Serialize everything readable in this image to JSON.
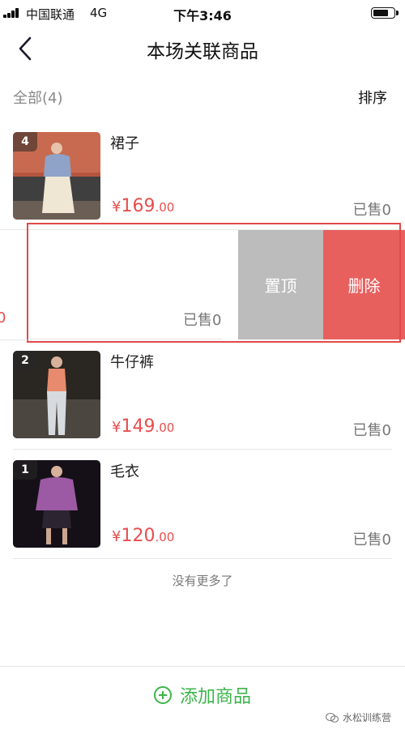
{
  "status_bar": {
    "carrier": "中国联通",
    "network": "4G",
    "time": "下午3:46"
  },
  "nav": {
    "title": "本场关联商品"
  },
  "filter": {
    "all_label": "全部(4)",
    "sort_label": "排序"
  },
  "products": [
    {
      "rank": "4",
      "name": "裙子",
      "currency": "¥",
      "price_int": "169",
      "price_dec": ".00",
      "sold": "已售0"
    },
    {
      "rank": "2",
      "name": "牛仔裤",
      "currency": "¥",
      "price_int": "149",
      "price_dec": ".00",
      "sold": "已售0"
    },
    {
      "rank": "1",
      "name": "毛衣",
      "currency": "¥",
      "price_int": "120",
      "price_dec": ".00",
      "sold": "已售0"
    }
  ],
  "swipe_row": {
    "sold": "已售0",
    "price_tail": "0",
    "pin_label": "置顶",
    "delete_label": "删除"
  },
  "list_end": "没有更多了",
  "bottom": {
    "add_label": "添加商品"
  },
  "watermark": "水松训练营",
  "colors": {
    "accent_green": "#3cb54a",
    "price_red": "#e84e4e",
    "delete_red": "#e8605e",
    "pin_gray": "#bcbcbc"
  }
}
